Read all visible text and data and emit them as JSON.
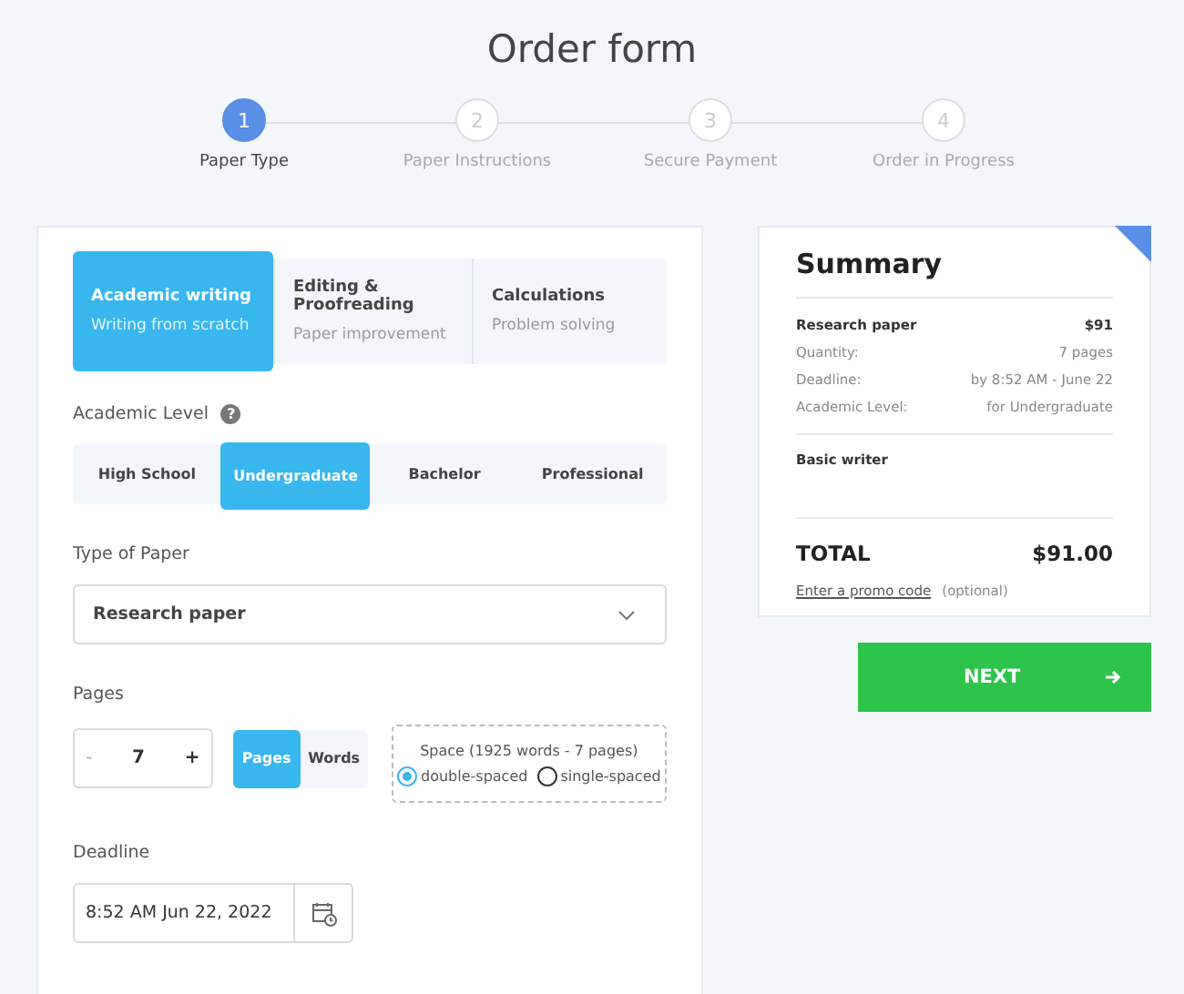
{
  "title": "Order form",
  "steps": [
    {
      "number": "1",
      "label": "Paper Type",
      "selected": true
    },
    {
      "number": "2",
      "label": "Paper Instructions",
      "selected": false
    },
    {
      "number": "3",
      "label": "Secure Payment",
      "selected": false
    },
    {
      "number": "4",
      "label": "Order in Progress",
      "selected": false
    }
  ],
  "services": [
    {
      "title": "Academic writing",
      "subtitle": "Writing from scratch",
      "selected": true
    },
    {
      "title": "Editing & Proofreading",
      "subtitle": "Paper improvement",
      "selected": false
    },
    {
      "title": "Calculations",
      "subtitle": "Problem solving",
      "selected": false
    }
  ],
  "academic_level": {
    "label": "Academic Level",
    "help": "?",
    "options": [
      {
        "label": "High School",
        "selected": false
      },
      {
        "label": "Undergraduate",
        "selected": true
      },
      {
        "label": "Bachelor",
        "selected": false
      },
      {
        "label": "Professional",
        "selected": false
      }
    ]
  },
  "paper_type": {
    "label": "Type of Paper",
    "value": "Research paper"
  },
  "pages": {
    "label": "Pages",
    "minus": "-",
    "value": "7",
    "plus": "+",
    "units": [
      {
        "label": "Pages",
        "selected": true
      },
      {
        "label": "Words",
        "selected": false
      }
    ]
  },
  "spacing": {
    "label": "Space (1925 words - 7 pages)",
    "options": [
      {
        "label": "double-spaced",
        "selected": true
      },
      {
        "label": "single-spaced",
        "selected": false
      }
    ]
  },
  "deadline": {
    "label": "Deadline",
    "value": "8:52 AM Jun 22, 2022"
  },
  "summary": {
    "title": "Summary",
    "item": "Research paper",
    "price": "$91",
    "rows": [
      {
        "label": "Quantity:",
        "value": "7 pages"
      },
      {
        "label": "Deadline:",
        "value": "by 8:52 AM - June 22"
      },
      {
        "label": "Academic Level:",
        "value": "for Undergraduate"
      }
    ],
    "writer": "Basic writer",
    "total_label": "TOTAL",
    "total": "$91.00",
    "promo_link": "Enter a promo code",
    "promo_note": "(optional)"
  },
  "next_button": "NEXT"
}
